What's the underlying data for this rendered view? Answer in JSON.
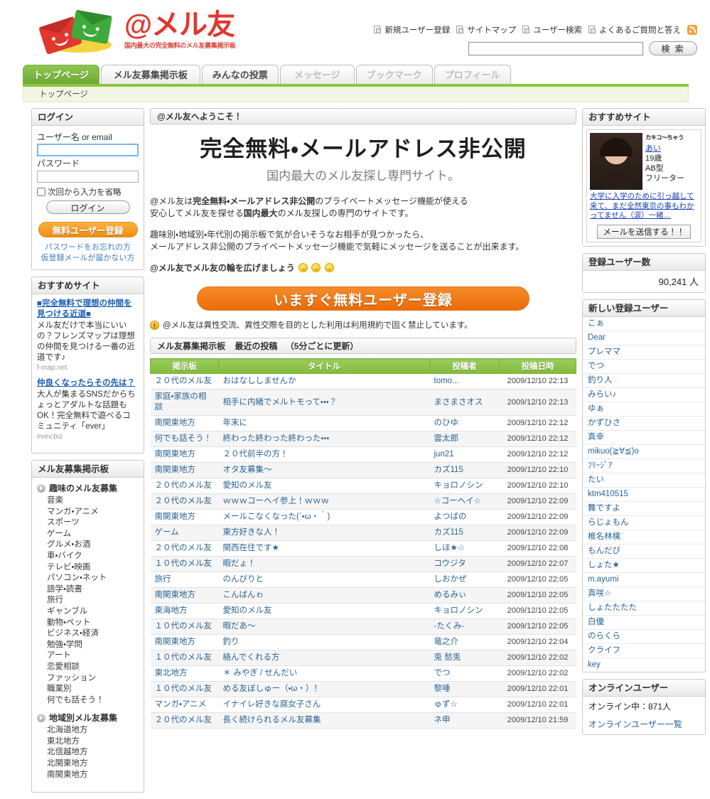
{
  "brand": {
    "title": "@メル友",
    "tagline": "国内最大の完全無料のメル友募集掲示板"
  },
  "header": {
    "links": [
      "新規ユーザー登録",
      "サイトマップ",
      "ユーザー検索",
      "よくあるご質問と答え"
    ],
    "search": {
      "value": "",
      "button": "検 索"
    }
  },
  "tabs": [
    {
      "label": "トップページ",
      "state": "active"
    },
    {
      "label": "メル友募集掲示板",
      "state": "normal"
    },
    {
      "label": "みんなの投票",
      "state": "normal"
    },
    {
      "label": "メッセージ",
      "state": "disabled"
    },
    {
      "label": "ブックマーク",
      "state": "disabled"
    },
    {
      "label": "プロフィール",
      "state": "disabled"
    }
  ],
  "breadcrumb": "トップページ",
  "login": {
    "heading": "ログイン",
    "user_label": "ユーザー名 or email",
    "user_value": "",
    "password_label": "パスワード",
    "password_value": "",
    "remember_label": "次回から入力を省略",
    "login_button": "ログイン",
    "free_register_button": "無料ユーザー登録",
    "links": [
      "パスワードをお忘れの方",
      "仮登録メールが届かない方"
    ]
  },
  "left_ads": {
    "heading": "おすすめサイト",
    "items": [
      {
        "title": "■完全無料で理想の仲間を見つける近道■",
        "desc": "メル友だけで本当にいいの？フレンズマップは理想の仲間を見つける一番の近道です♪",
        "url": "f-map.net"
      },
      {
        "title": "仲良くなったらその先は？",
        "desc": "大人が集まるSNSだからちょっとアダルトな話題もOK！完全無料で遊べるコミュニティ「ever」",
        "url": "evev.biz"
      }
    ]
  },
  "categories": {
    "heading": "メル友募集掲示板",
    "groups": [
      {
        "title": "趣味のメル友募集",
        "items": [
          "音楽",
          "マンガ・アニメ",
          "スポーツ",
          "ゲーム",
          "グルメ・お酒",
          "車・バイク",
          "テレビ・映画",
          "パソコン・ネット",
          "語学・読書",
          "旅行",
          "ギャンブル",
          "動物・ペット",
          "ビジネス・経済",
          "勉強・学問",
          "アート",
          "恋愛相談",
          "ファッション",
          "職業別",
          "何でも話そう！"
        ]
      },
      {
        "title": "地域別メル友募集",
        "items": [
          "北海道地方",
          "東北地方",
          "北信越地方",
          "北関東地方",
          "南関東地方"
        ]
      }
    ]
  },
  "welcome_bar": "@メル友へようこそ！",
  "hero": {
    "headline": "完全無料・メールアドレス非公開",
    "subhead": "国内最大のメル友探し専門サイト。"
  },
  "copy": {
    "p1_a": "@メル友は",
    "p1_b": "完全無料・メールアドレス非公開",
    "p1_c": "のプライベートメッセージ機能が使える",
    "p1_d": "安心してメル友を探せる",
    "p1_e": "国内最大",
    "p1_f": "のメル友探しの専門のサイトです。",
    "p2_a": "趣味別・地域別・年代別の掲示板で気が合いそうなお相手が見つかったら、",
    "p2_b": "メールアドレス非公開のプライベートメッセージ機能で気軽にメッセージを送ることが出来ます。",
    "p3": "@メル友でメル友の輪を広げましょう"
  },
  "cta_button": "いますぐ無料ユーザー登録",
  "notice": "@メル友は異性交流、異性交際を目的とした利用は利用規約で固く禁止しています。",
  "board": {
    "title": "メル友募集掲示板",
    "subtitle": "最近の投稿",
    "frequency": "（5分ごとに更新）",
    "columns": [
      "掲示板",
      "タイトル",
      "投稿者",
      "投稿日時"
    ],
    "rows": [
      {
        "board": "２０代のメル友",
        "title": "おはなししませんか",
        "author": "tomo...",
        "date": "2009/12/10 22:13"
      },
      {
        "board": "家庭・家族の相談",
        "title": "相手に内緒でメルトモって・・・？",
        "author": "まさまさオス",
        "date": "2009/12/10 22:13"
      },
      {
        "board": "南関東地方",
        "title": "年末に",
        "author": "のひゆ",
        "date": "2009/12/10 22:12"
      },
      {
        "board": "何でも話そう！",
        "title": "終わった終わった終わった・・・",
        "author": "雲太郎",
        "date": "2009/12/10 22:12"
      },
      {
        "board": "南関東地方",
        "title": "２０代前半の方！",
        "author": "jun21",
        "date": "2009/12/10 22:12"
      },
      {
        "board": "南関東地方",
        "title": "オタ友募集〜",
        "author": "カズ115",
        "date": "2009/12/10 22:10"
      },
      {
        "board": "２０代のメル友",
        "title": "愛知のメル友",
        "author": "キョロノシン",
        "date": "2009/12/10 22:10"
      },
      {
        "board": "２０代のメル友",
        "title": "ｗｗｗコーヘイ参上！ｗｗｗ",
        "author": "☆コーヘイ☆",
        "date": "2009/12/10 22:09"
      },
      {
        "board": "南関東地方",
        "title": "メールこなくなった(´・ω・｀)",
        "author": "よつばの",
        "date": "2009/12/10 22:09"
      },
      {
        "board": "ゲーム",
        "title": "東方好きな人！",
        "author": "カズ115",
        "date": "2009/12/10 22:09"
      },
      {
        "board": "２０代のメル友",
        "title": "関西在住です★",
        "author": "しほ★☆",
        "date": "2009/12/10 22:08"
      },
      {
        "board": "１０代のメル友",
        "title": "暇だょ！",
        "author": "コウジタ",
        "date": "2009/12/10 22:07"
      },
      {
        "board": "旅行",
        "title": "のんびりと",
        "author": "しおかぜ",
        "date": "2009/12/10 22:05"
      },
      {
        "board": "南関東地方",
        "title": "こんばんゎ",
        "author": "めるみぃ",
        "date": "2009/12/10 22:05"
      },
      {
        "board": "東海地方",
        "title": "愛知のメル友",
        "author": "キョロノシン",
        "date": "2009/12/10 22:05"
      },
      {
        "board": "１０代のメル友",
        "title": "暇だあ〜",
        "author": "-たくみ-",
        "date": "2009/12/10 22:05"
      },
      {
        "board": "南関東地方",
        "title": "釣り",
        "author": "竜之介",
        "date": "2009/12/10 22:04"
      },
      {
        "board": "１０代のメル友",
        "title": "絡んでくれる方",
        "author": "兎 愁兎",
        "date": "2009/12/10 22:02"
      },
      {
        "board": "東北地方",
        "title": "＊ みやぎ / せんだい",
        "author": "でつ",
        "date": "2009/12/10 22:02"
      },
      {
        "board": "１０代のメル友",
        "title": "める友ぼしゅー（・ω・）！",
        "author": "黎唾",
        "date": "2009/12/10 22:01"
      },
      {
        "board": "マンガ・アニメ",
        "title": "イナイレ好きな腐女子さん",
        "author": "ゅず☆",
        "date": "2009/12/10 22:01"
      },
      {
        "board": "２０代のメル友",
        "title": "長く続けられるメル友募集",
        "author": "ネ申",
        "date": "2009/12/10 21:59"
      }
    ]
  },
  "right_ad": {
    "heading": "おすすめサイト",
    "brand": "カキコ〜ちゃう",
    "name": "あい",
    "age": "19歳",
    "blood": "AB型",
    "job": "フリーター",
    "blurb": "大学に入学のために引っ越して来て、まだ全然東京の事もわかってません（涙）一緒…",
    "button": "メールを送信する！！"
  },
  "registered": {
    "heading": "登録ユーザー数",
    "value": "90,241 人"
  },
  "new_users": {
    "heading": "新しい登録ユーザー",
    "items": [
      "こぁ",
      "Dear",
      "プレママ",
      "でつ",
      "釣り人",
      "みらい♪",
      "ゆぁ",
      "かずひさ",
      "真幸",
      "mikuo(≧∀≦)o",
      "ﾌﾘｰｼﾞｱ",
      "たい",
      "ktm410515",
      "舞ですよ",
      "らじょもん",
      "椎名林檎",
      "もんだび",
      "しょた★",
      "m.ayumi",
      "真咲☆",
      "しょたたたた",
      "白優",
      "のらくら",
      "クライフ",
      "key"
    ]
  },
  "online": {
    "heading": "オンラインユーザー",
    "count_label": "オンライン中：871人",
    "list_link": "オンラインユーザー一覧"
  },
  "colors": {
    "accent_green": "#8cc63e",
    "accent_orange": "#ec6c09",
    "brand_red": "#e0372f",
    "link_blue": "#2a6496"
  }
}
